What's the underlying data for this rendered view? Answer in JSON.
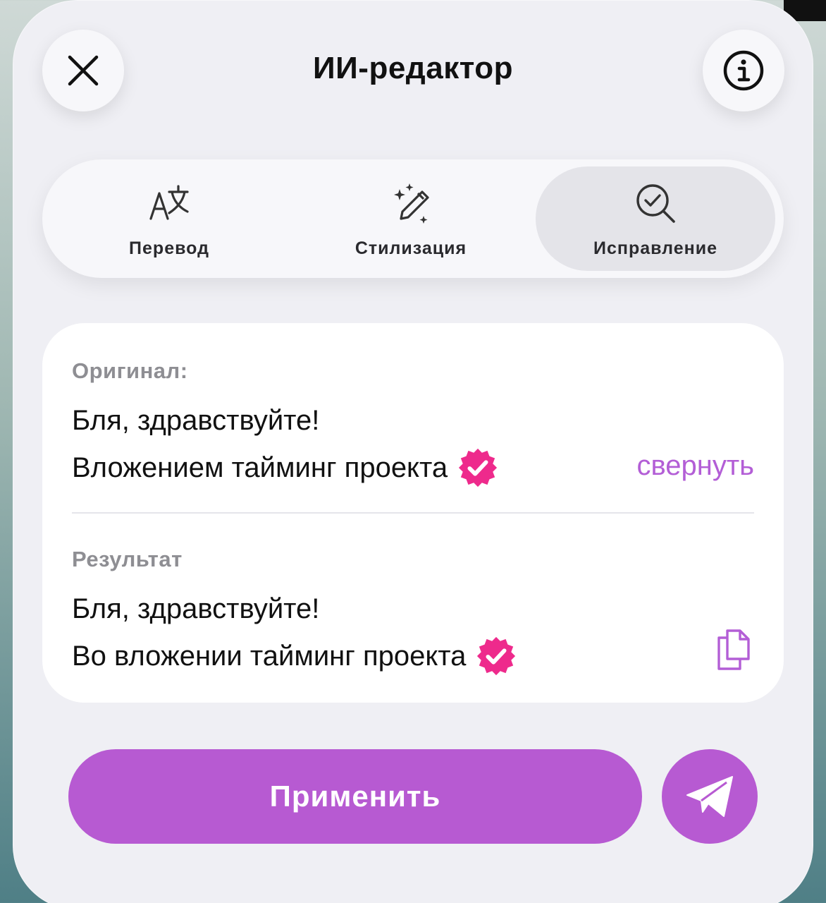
{
  "header": {
    "title": "ИИ-редактор",
    "close_icon": "close-icon",
    "info_icon": "info-icon"
  },
  "tabs": [
    {
      "label": "Перевод",
      "icon": "translate-icon",
      "selected": false
    },
    {
      "label": "Стилизация",
      "icon": "magic-pencil-icon",
      "selected": false
    },
    {
      "label": "Исправление",
      "icon": "search-check-icon",
      "selected": true
    }
  ],
  "original": {
    "label": "Оригинал:",
    "line1": "Бля, здравствуйте!",
    "line2": "Вложением тайминг проекта",
    "collapse_label": "свернуть"
  },
  "result": {
    "label": "Результат",
    "line1": "Бля, здравствуйте!",
    "line2": "Во вложении тайминг проекта",
    "copy_icon": "copy-icon"
  },
  "actions": {
    "apply_label": "Применить",
    "send_icon": "send-icon"
  },
  "colors": {
    "accent": "#b75ad2",
    "badge": "#ee2a8c",
    "sheet_bg": "#efeff4",
    "muted_text": "#8e8e93"
  }
}
